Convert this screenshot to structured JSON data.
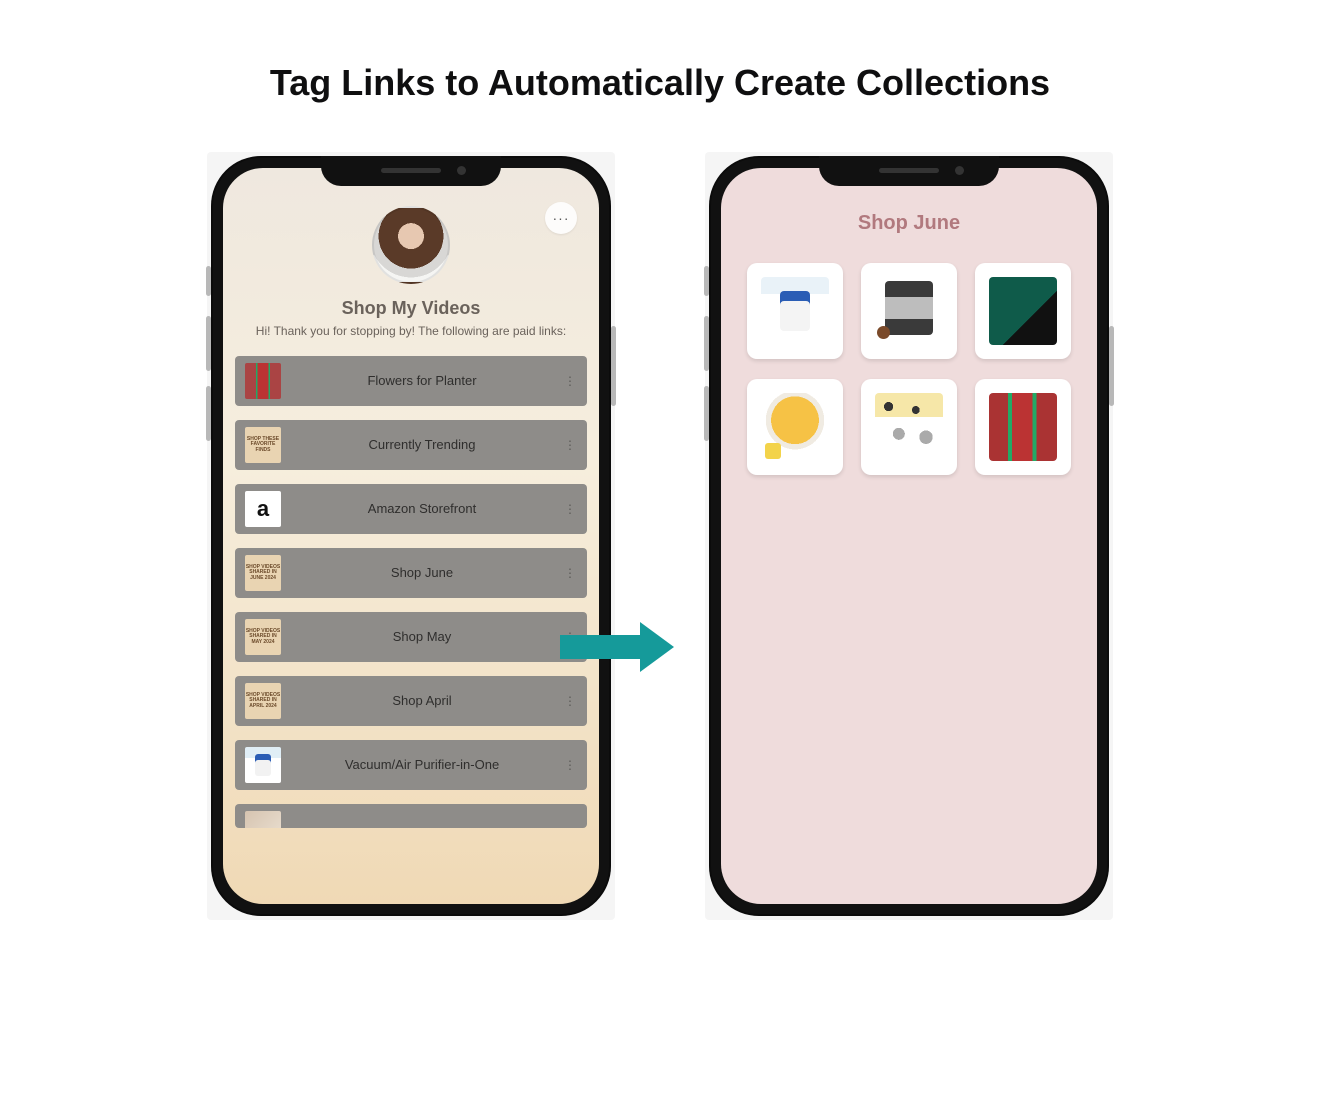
{
  "title": "Tag Links to Automatically Create Collections",
  "leftPhone": {
    "moreGlyph": "···",
    "profileTitle": "Shop My Videos",
    "profileSubtitle": "Hi! Thank you for stopping by! The following are paid links:",
    "links": [
      {
        "label": "Flowers for Planter",
        "thumbType": "flowers",
        "thumbText": ""
      },
      {
        "label": "Currently Trending",
        "thumbType": "tan",
        "thumbText": "SHOP THESE FAVORITE FINDS"
      },
      {
        "label": "Amazon Storefront",
        "thumbType": "amazon",
        "thumbText": "a"
      },
      {
        "label": "Shop June",
        "thumbType": "tan",
        "thumbText": "SHOP VIDEOS SHARED IN JUNE 2024"
      },
      {
        "label": "Shop May",
        "thumbType": "tan",
        "thumbText": "SHOP VIDEOS SHARED IN MAY 2024"
      },
      {
        "label": "Shop April",
        "thumbType": "tan",
        "thumbText": "SHOP VIDEOS SHARED IN APRIL 2024"
      },
      {
        "label": "Vacuum/Air Purifier-in-One",
        "thumbType": "vacuum",
        "thumbText": ""
      }
    ],
    "rowMoreGlyph": "⋮"
  },
  "rightPhone": {
    "collectionTitle": "Shop June",
    "products": [
      "p1",
      "p2",
      "p3",
      "p4",
      "p5",
      "p6"
    ]
  }
}
